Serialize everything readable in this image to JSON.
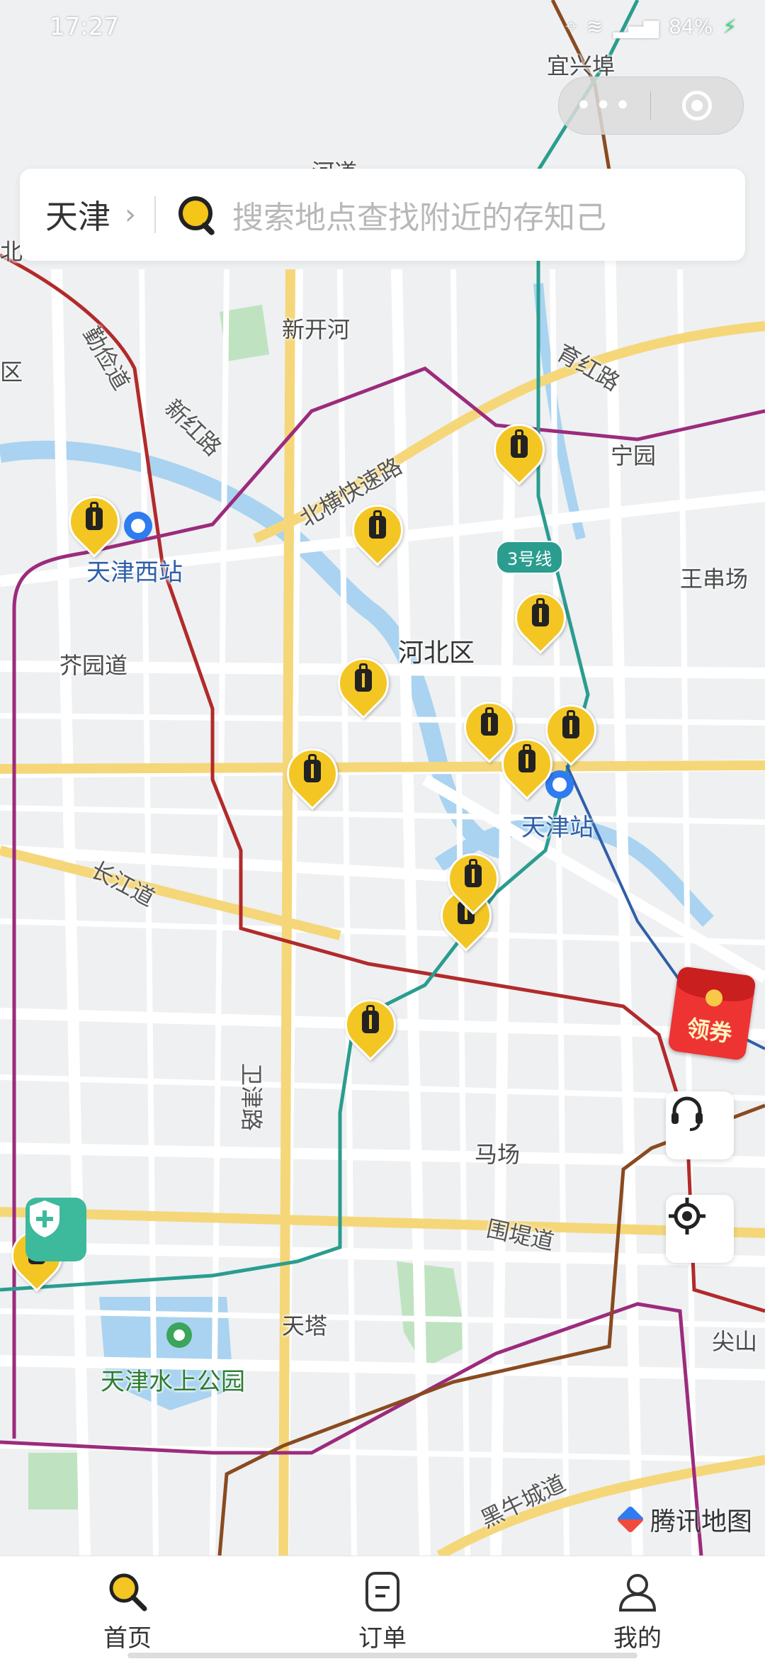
{
  "status_bar": {
    "time": "17:27",
    "battery": "84%"
  },
  "capsule": {
    "more_label": "•••"
  },
  "search": {
    "city": "天津",
    "chevron": "›",
    "placeholder": "搜索地点查找附近的存知己"
  },
  "map": {
    "labels": {
      "yixingbu": "宜兴埠",
      "xinkaihe": "新开河",
      "yuhonglu": "育红路",
      "ningyuan": "宁园",
      "wangchuanchang": "王串场",
      "hebeiqu": "河北区",
      "tianjinxi": "天津西站",
      "jieyuandao": "芥园道",
      "tianjinzhan": "天津站",
      "changjiangdao": "长江道",
      "weijinlu": "卫津路",
      "machang": "马场",
      "weididao": "围堤道",
      "tianta": "天塔",
      "shuishang": "天津水上公园",
      "jianshan": "尖山",
      "heniucheng": "黑牛城道",
      "beihengkuaisu": "北横快速路",
      "xinhonglu": "新红路",
      "qinjiandao": "勤俭道",
      "qu_left": "区",
      "bei_left": "北",
      "hedao": "河道"
    },
    "line_badge": "3号线",
    "pins": [
      {
        "name": "storage-pin-1"
      },
      {
        "name": "storage-pin-2"
      },
      {
        "name": "storage-pin-3"
      },
      {
        "name": "storage-pin-4"
      },
      {
        "name": "storage-pin-5"
      },
      {
        "name": "storage-pin-6"
      },
      {
        "name": "storage-pin-7"
      },
      {
        "name": "storage-pin-8"
      },
      {
        "name": "storage-pin-9"
      },
      {
        "name": "storage-pin-10"
      },
      {
        "name": "storage-pin-11"
      },
      {
        "name": "storage-pin-12"
      },
      {
        "name": "storage-pin-13"
      }
    ],
    "attribution": "腾讯地图"
  },
  "coupon": {
    "label": "领券"
  },
  "tabs": [
    {
      "label": "首页",
      "icon": "search-icon"
    },
    {
      "label": "订单",
      "icon": "order-icon"
    },
    {
      "label": "我的",
      "icon": "user-icon"
    }
  ],
  "colors": {
    "accent": "#f3c623",
    "metro_red": "#b22a2a",
    "metro_purple": "#9c2b7c",
    "metro_teal": "#2a9d8f"
  }
}
